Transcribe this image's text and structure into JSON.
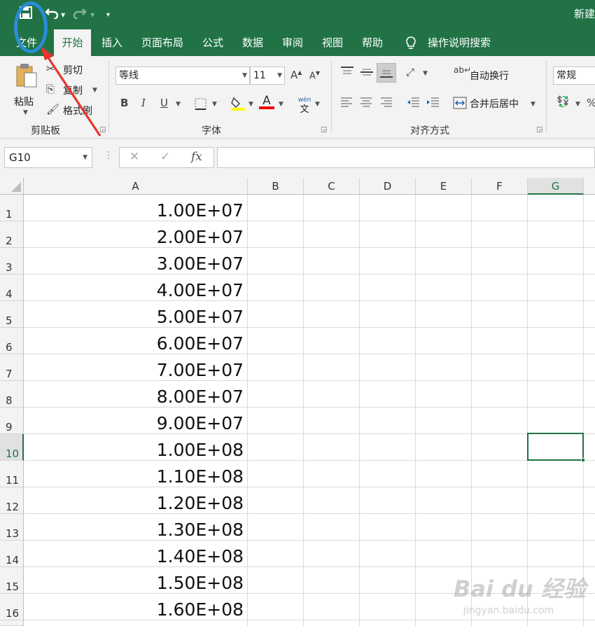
{
  "title_bar": {
    "title": "新建"
  },
  "qat": {
    "save_icon": "save-icon",
    "undo_icon": "undo-icon",
    "redo_icon": "redo-icon",
    "customize_icon": "qat-customize-icon"
  },
  "tabs": [
    {
      "label": "文件"
    },
    {
      "label": "开始"
    },
    {
      "label": "插入"
    },
    {
      "label": "页面布局"
    },
    {
      "label": "公式"
    },
    {
      "label": "数据"
    },
    {
      "label": "审阅"
    },
    {
      "label": "视图"
    },
    {
      "label": "帮助"
    }
  ],
  "tell_me": "操作说明搜索",
  "clipboard": {
    "paste": "粘贴",
    "cut": "剪切",
    "copy": "复制",
    "format_painter": "格式刷",
    "group": "剪贴板"
  },
  "font": {
    "name": "等线",
    "size": "11",
    "group": "字体",
    "bold": "B",
    "italic": "I",
    "underline": "U",
    "color_letter": "A",
    "phonetic": "wén"
  },
  "alignment": {
    "wrap": "自动换行",
    "merge": "合并后居中",
    "group": "对齐方式"
  },
  "number": {
    "format": "常规",
    "percent": "%"
  },
  "formula_bar": {
    "name_box": "G10",
    "cancel": "✕",
    "enter": "✓",
    "fx": "fx",
    "content": ""
  },
  "columns": [
    "A",
    "B",
    "C",
    "D",
    "E",
    "F",
    "G"
  ],
  "rows": [
    {
      "num": "1",
      "a": "1.00E+07"
    },
    {
      "num": "2",
      "a": "2.00E+07"
    },
    {
      "num": "3",
      "a": "3.00E+07"
    },
    {
      "num": "4",
      "a": "4.00E+07"
    },
    {
      "num": "5",
      "a": "5.00E+07"
    },
    {
      "num": "6",
      "a": "6.00E+07"
    },
    {
      "num": "7",
      "a": "7.00E+07"
    },
    {
      "num": "8",
      "a": "8.00E+07"
    },
    {
      "num": "9",
      "a": "9.00E+07"
    },
    {
      "num": "10",
      "a": "1.00E+08"
    },
    {
      "num": "11",
      "a": "1.10E+08"
    },
    {
      "num": "12",
      "a": "1.20E+08"
    },
    {
      "num": "13",
      "a": "1.30E+08"
    },
    {
      "num": "14",
      "a": "1.40E+08"
    },
    {
      "num": "15",
      "a": "1.50E+08"
    },
    {
      "num": "16",
      "a": "1.60E+08"
    }
  ],
  "selected_cell": "G10",
  "watermark": {
    "brand": "Bai du 经验",
    "url": "jingyan.baidu.com"
  },
  "colors": {
    "accent": "#217346",
    "annotation_ellipse": "#2a8cd8",
    "annotation_arrow": "#e8352d"
  }
}
